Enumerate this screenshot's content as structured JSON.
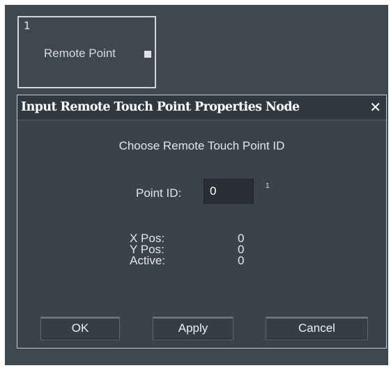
{
  "node": {
    "index": "1",
    "label": "Remote Point"
  },
  "dialog": {
    "title": "Input Remote Touch Point Properties Node",
    "close_glyph": "✕",
    "heading": "Choose  Remote Touch Point ID",
    "point_id_label": "Point ID:",
    "point_id_value": "0",
    "point_id_superscript": "1",
    "info": [
      {
        "label": "X Pos:",
        "value": "0"
      },
      {
        "label": "Y Pos:",
        "value": "0"
      },
      {
        "label": "Active:",
        "value": "0"
      }
    ],
    "buttons": {
      "ok": "OK",
      "apply": "Apply",
      "cancel": "Cancel"
    }
  },
  "colors": {
    "background": "#3f4750",
    "dialog_bg": "#3a434c",
    "titlebar_bg": "#313940",
    "text": "#e4e6e8"
  }
}
